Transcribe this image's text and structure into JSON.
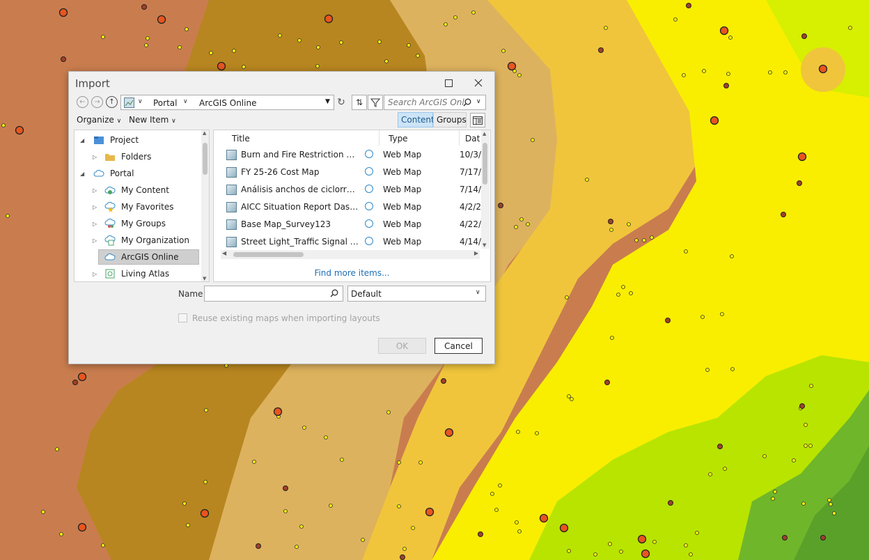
{
  "dialog": {
    "title": "Import",
    "nav": {
      "portal": "Portal",
      "location": "ArcGIS Online",
      "search_placeholder": "Search ArcGIS Onli..."
    },
    "toolbar": {
      "organize": "Organize",
      "new_item": "New Item",
      "content_tab": "Content",
      "groups_tab": "Groups"
    },
    "tree": [
      {
        "label": "Project"
      },
      {
        "label": "Folders"
      },
      {
        "label": "Portal"
      },
      {
        "label": "My Content"
      },
      {
        "label": "My Favorites"
      },
      {
        "label": "My Groups"
      },
      {
        "label": "My Organization"
      },
      {
        "label": "ArcGIS Online"
      },
      {
        "label": "Living Atlas"
      }
    ],
    "columns": {
      "title": "Title",
      "type": "Type",
      "date": "Dat"
    },
    "items": [
      {
        "title": "Burn and Fire Restriction Map",
        "type": "Web Map",
        "date": "10/3/"
      },
      {
        "title": "FY 25-26 Cost Map",
        "type": "Web Map",
        "date": "7/17/"
      },
      {
        "title": "Análisis anchos de ciclorruta",
        "type": "Web Map",
        "date": "7/14/"
      },
      {
        "title": "AICC Situation Report Dashboard",
        "type": "Web Map",
        "date": "4/2/2"
      },
      {
        "title": "Base Map_Survey123",
        "type": "Web Map",
        "date": "4/22/"
      },
      {
        "title": "Street Light_Traffic Signal Conflicts",
        "type": "Web Map",
        "date": "4/14/"
      }
    ],
    "find_more": "Find more items...",
    "name_label": "Name",
    "name_value": "",
    "filter_value": "Default",
    "reuse_label": "Reuse existing maps when importing layouts",
    "ok_label": "OK",
    "cancel_label": "Cancel"
  }
}
